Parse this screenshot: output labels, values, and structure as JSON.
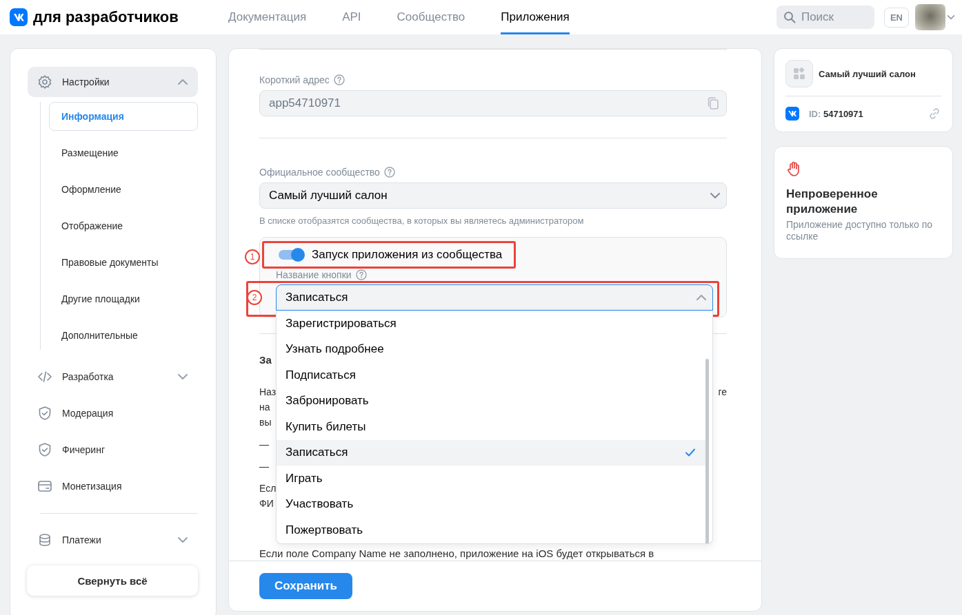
{
  "header": {
    "logo_text": "для разработчиков",
    "nav": [
      {
        "label": "Документация",
        "selected": false
      },
      {
        "label": "API",
        "selected": false
      },
      {
        "label": "Сообщество",
        "selected": false
      },
      {
        "label": "Приложения",
        "selected": true
      }
    ],
    "search": {
      "placeholder": "Поиск"
    },
    "language": "EN"
  },
  "sidebar": {
    "items": [
      {
        "kind": "group",
        "label": "Настройки",
        "expanded": true,
        "children": [
          {
            "label": "Информация",
            "selected": true
          },
          {
            "label": "Размещение",
            "selected": false
          },
          {
            "label": "Оформление",
            "selected": false
          },
          {
            "label": "Отображение",
            "selected": false
          },
          {
            "label": "Правовые документы",
            "selected": false
          },
          {
            "label": "Другие площадки",
            "selected": false
          },
          {
            "label": "Дополнительные",
            "selected": false
          }
        ]
      },
      {
        "kind": "group",
        "label": "Разработка",
        "expanded": false
      },
      {
        "kind": "item",
        "label": "Модерация"
      },
      {
        "kind": "item",
        "label": "Фичеринг"
      },
      {
        "kind": "item",
        "label": "Монетизация"
      },
      {
        "kind": "divider"
      },
      {
        "kind": "group",
        "label": "Платежи",
        "expanded": false
      }
    ],
    "collapse_button": "Свернуть всё"
  },
  "main": {
    "short_address": {
      "label": "Короткий адрес",
      "value": "app54710971",
      "disabled": true
    },
    "official_community": {
      "label": "Официальное сообщество",
      "value": "Самый лучший салон",
      "hint": "В списке отобразятся сообщества, в которых вы являетесь администратором"
    },
    "launch_toggle": {
      "label": "Запуск приложения из сообщества",
      "on": true,
      "annotation": "1"
    },
    "button_name": {
      "label": "Название кнопки",
      "value": "Записаться",
      "expanded": true,
      "annotation": "2",
      "options": [
        {
          "label": "Зарегистрироваться",
          "selected": false
        },
        {
          "label": "Узнать подробнее",
          "selected": false
        },
        {
          "label": "Подписаться",
          "selected": false
        },
        {
          "label": "Забронировать",
          "selected": false
        },
        {
          "label": "Купить билеты",
          "selected": false
        },
        {
          "label": "Записаться",
          "selected": true
        },
        {
          "label": "Играть",
          "selected": false
        },
        {
          "label": "Участвовать",
          "selected": false
        },
        {
          "label": "Пожертвовать",
          "selected": false
        }
      ]
    },
    "covered_text": [
      {
        "kind": "heading",
        "left": "За"
      },
      {
        "kind": "line",
        "left": "Наз",
        "right": "ге"
      },
      {
        "kind": "line",
        "left": "на"
      },
      {
        "kind": "line",
        "left": "вы"
      },
      {
        "kind": "gap"
      },
      {
        "kind": "line",
        "left": "—"
      },
      {
        "kind": "gap"
      },
      {
        "kind": "line",
        "left": "—"
      },
      {
        "kind": "gap"
      },
      {
        "kind": "line",
        "left": "Есл"
      },
      {
        "kind": "line",
        "left": "ФИ"
      },
      {
        "kind": "gap"
      },
      {
        "kind": "full",
        "left": "Если поле Company Name не заполнено, приложение на iOS будет открываться в"
      }
    ],
    "save_button": "Сохранить"
  },
  "aside": {
    "app_card": {
      "name": "Самый лучший салон",
      "id_label": "ID:",
      "id": "54710971"
    },
    "status_card": {
      "title": "Непроверенное приложение",
      "text": "Приложение доступно только по ссылке"
    }
  }
}
